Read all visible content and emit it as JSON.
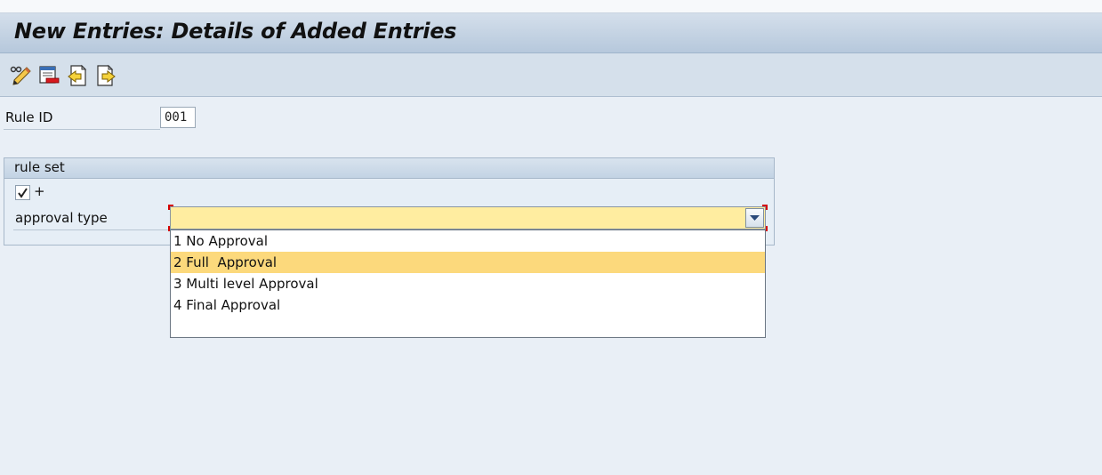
{
  "window": {
    "title": "New Entries: Details of Added Entries"
  },
  "toolbar": {
    "buttons": [
      {
        "icon": "display-change-icon"
      },
      {
        "icon": "delete-icon"
      },
      {
        "icon": "previous-entry-icon"
      },
      {
        "icon": "next-entry-icon"
      }
    ]
  },
  "fields": {
    "rule_id": {
      "label": "Rule ID",
      "value": "001"
    }
  },
  "rule_set": {
    "title": "rule set",
    "checkbox": {
      "checked": true,
      "label": "+"
    },
    "approval_type": {
      "label": "approval type",
      "value": "",
      "options": [
        {
          "label": "1 No Approval",
          "selected": false
        },
        {
          "label": "2 Full  Approval",
          "selected": true
        },
        {
          "label": "3 Multi level Approval",
          "selected": false
        },
        {
          "label": "4 Final Approval",
          "selected": false
        }
      ]
    }
  },
  "colors": {
    "title_bar": "#b6c8dc",
    "input_required": "#ffeda0",
    "highlight": "#fcd97c",
    "required_marker": "#d40000"
  }
}
